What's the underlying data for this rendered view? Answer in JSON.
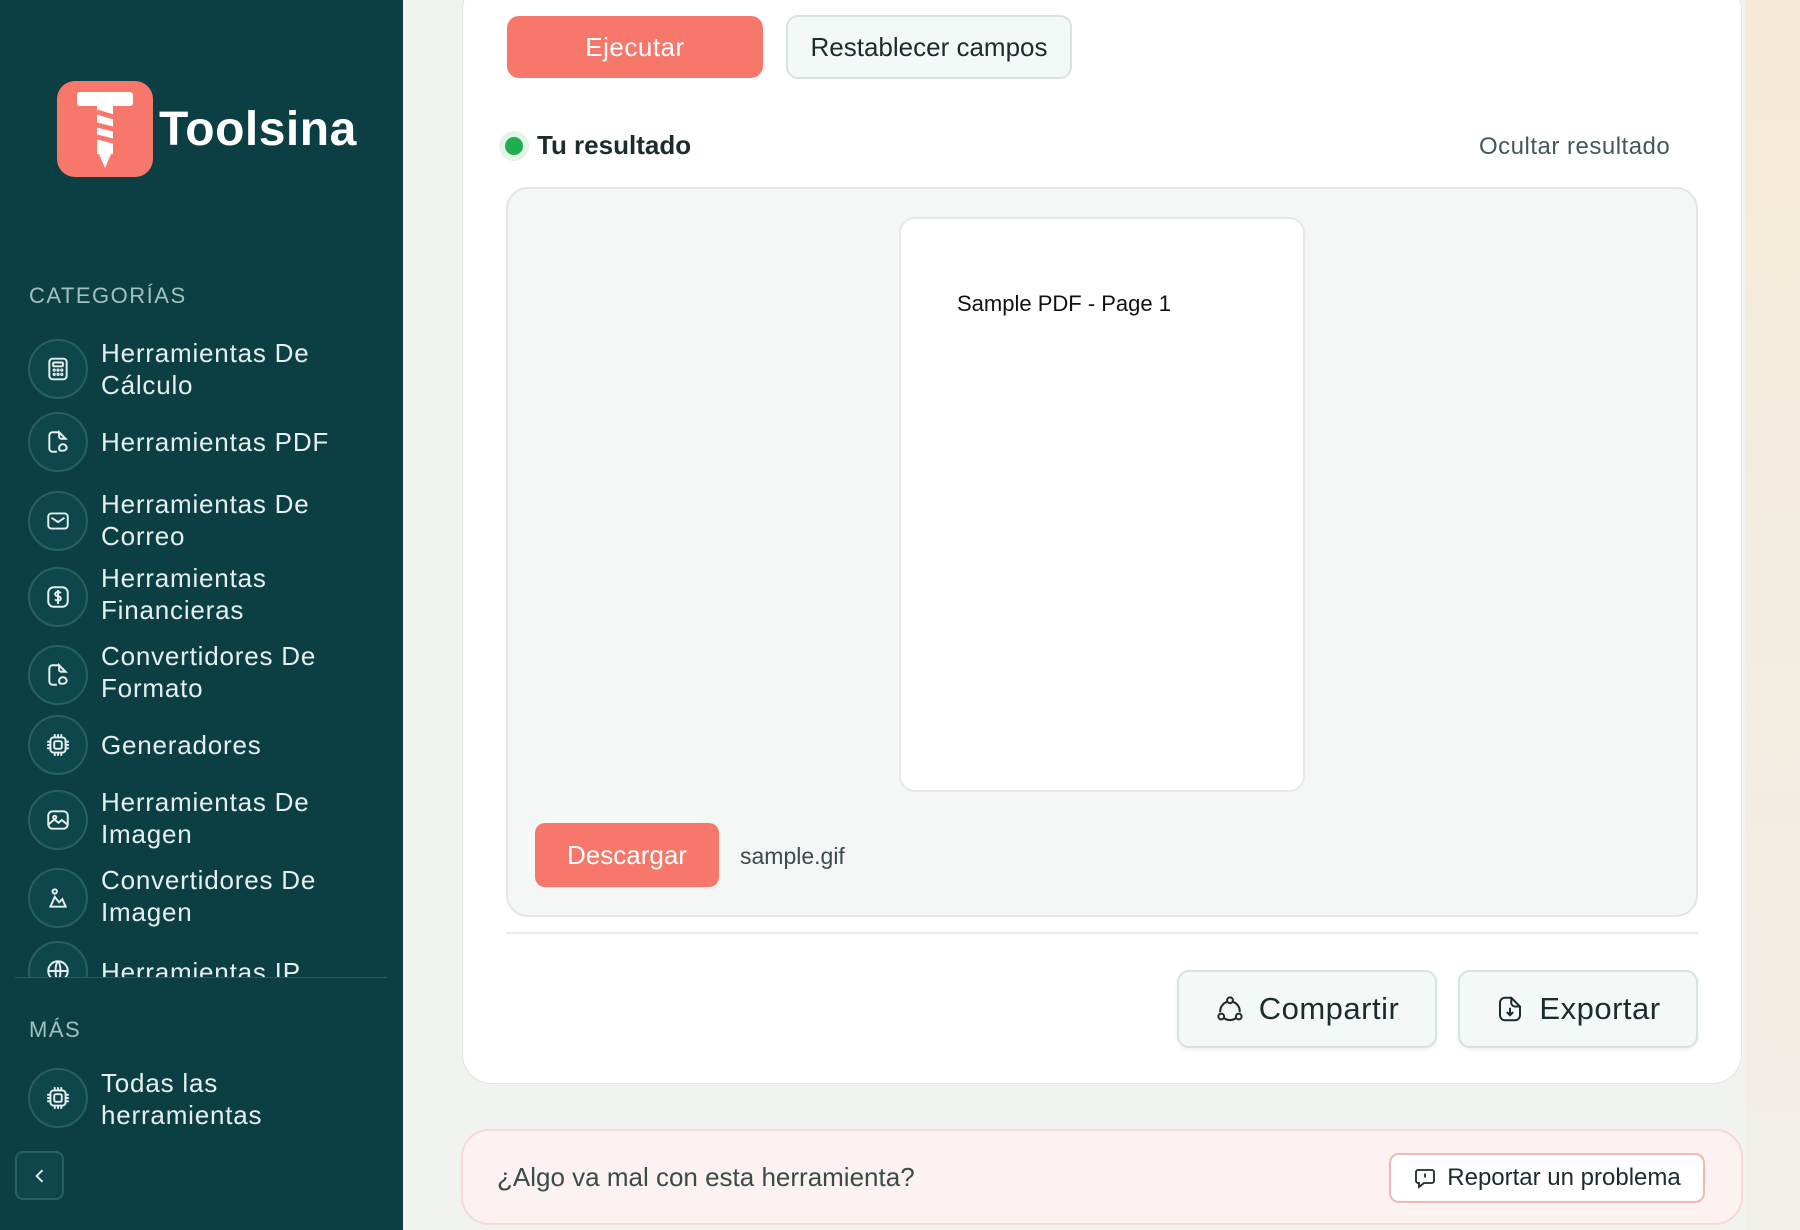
{
  "app": {
    "name": "Toolsina",
    "brand_color": "#f7786a",
    "sidebar_color": "#0b3f43"
  },
  "sidebar": {
    "categories_title": "CATEGORÍAS",
    "categories": [
      {
        "label": "Herramientas De Cálculo",
        "icon": "calculator-icon"
      },
      {
        "label": "Herramientas PDF",
        "icon": "file-icon"
      },
      {
        "label": "Herramientas De Correo",
        "icon": "mail-icon"
      },
      {
        "label": "Herramientas Financieras",
        "icon": "dollar-icon"
      },
      {
        "label": "Convertidores De Formato",
        "icon": "file-icon"
      },
      {
        "label": "Generadores",
        "icon": "chip-icon"
      },
      {
        "label": "Herramientas De Imagen",
        "icon": "image-icon"
      },
      {
        "label": "Convertidores De Imagen",
        "icon": "image-icon"
      },
      {
        "label": "Herramientas IP",
        "icon": "globe-icon"
      }
    ],
    "more_title": "MÁS",
    "more_items": [
      {
        "label": "Todas las herramientas",
        "icon": "chip-icon"
      }
    ],
    "collapse_icon": "chevron-left-icon"
  },
  "actions": {
    "run_label": "Ejecutar",
    "reset_label": "Restablecer campos"
  },
  "result": {
    "title": "Tu resultado",
    "hide_label": "Ocultar resultado",
    "status_color": "#1fae4f",
    "preview_text": "Sample PDF - Page 1",
    "download_label": "Descargar",
    "file_name": "sample.gif",
    "share_label": "Compartir",
    "export_label": "Exportar"
  },
  "report": {
    "question": "¿Algo va mal con esta herramienta?",
    "button_label": "Reportar un problema"
  }
}
